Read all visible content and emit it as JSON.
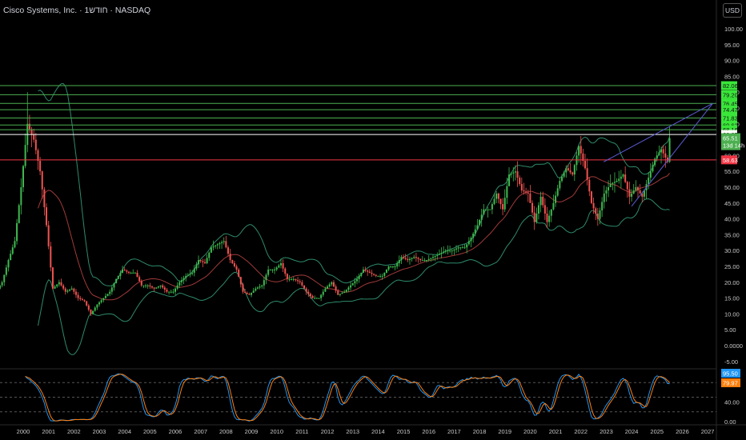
{
  "header": {
    "title": "Cisco Systems, Inc. · 1חודש · NASDAQ",
    "currency_button": "USD"
  },
  "colors": {
    "up": "#26a69a",
    "up_candle": "#3fb950",
    "down": "#ef5350",
    "level_line": "#4caf50",
    "level_tag": "#39e639",
    "support": "#f23645",
    "resistance": "#ffffff",
    "bands": "#2e8b6a",
    "basis": "#a13a3a",
    "trendline": "#5b5bd6",
    "k_line": "#2196f3",
    "d_line": "#ff7f0e"
  },
  "chart_data": [
    {
      "type": "candlestick",
      "title": "Cisco Systems, Inc. · 1חודש · NASDAQ",
      "x_tick_labels": [
        "2000",
        "2001",
        "2002",
        "2003",
        "2004",
        "2005",
        "2006",
        "2007",
        "2008",
        "2009",
        "2010",
        "2011",
        "2012",
        "2013",
        "2014",
        "2015",
        "2016",
        "2017",
        "2018",
        "2019",
        "2020",
        "2021",
        "2022",
        "2023",
        "2024",
        "2025",
        "2026",
        "2027"
      ],
      "y_tick_labels": [
        "100.00",
        "95.00",
        "90.00",
        "85.00",
        "80.00",
        "75.00",
        "70.00",
        "65.00",
        "60.00",
        "55.00",
        "50.00",
        "45.00",
        "40.00",
        "35.00",
        "30.00",
        "25.00",
        "20.00",
        "15.00",
        "10.00",
        "5.00",
        "0.0000",
        "-5.00"
      ],
      "ylim": [
        -5,
        100
      ],
      "start_year": 1999,
      "quarterly_close": [
        20,
        27,
        33,
        50,
        70,
        65,
        55,
        38,
        18,
        20,
        17,
        18,
        15,
        14,
        10,
        13,
        15,
        17,
        21,
        24,
        23,
        23,
        19,
        19,
        18,
        19,
        17,
        17,
        20,
        22,
        23,
        27,
        26,
        31,
        32,
        33,
        27,
        24,
        17,
        16,
        18,
        19,
        24,
        24,
        26,
        21,
        21,
        20,
        17,
        15,
        15,
        18,
        20,
        16,
        17,
        19,
        21,
        24,
        23,
        22,
        22,
        25,
        25,
        28,
        27,
        28,
        27,
        27,
        28,
        29,
        30,
        30,
        31,
        31,
        34,
        38,
        43,
        43,
        48,
        43,
        54,
        55,
        49,
        48,
        39,
        47,
        39,
        45,
        52,
        56,
        54,
        63,
        56,
        45,
        40,
        48,
        51,
        52,
        54,
        47,
        50,
        47,
        53,
        59,
        62,
        58,
        65.51
      ],
      "horizontal_levels": [
        {
          "value": 82.06,
          "label": "82.06",
          "kind": "level"
        },
        {
          "value": 79.2,
          "label": "79.20",
          "kind": "level"
        },
        {
          "value": 76.45,
          "label": "76.45",
          "kind": "level"
        },
        {
          "value": 74.47,
          "label": "74.47",
          "kind": "level"
        },
        {
          "value": 71.83,
          "label": "71.83",
          "kind": "level"
        },
        {
          "value": 69.63,
          "label": "69.63",
          "kind": "level"
        },
        {
          "value": 68.16,
          "label": "68.16",
          "kind": "level"
        },
        {
          "value": 66.65,
          "label": "66.65",
          "kind": "resistance"
        },
        {
          "value": 58.63,
          "label": "58.63",
          "kind": "support"
        }
      ],
      "last_price": {
        "value": 65.51,
        "label": "65.51",
        "countdown": "13d 14h"
      },
      "trendlines": [
        {
          "from": [
            2022.9,
            58
          ],
          "to": [
            2027.2,
            76.45
          ]
        },
        {
          "from": [
            2024.0,
            44
          ],
          "to": [
            2027.2,
            76.45
          ]
        }
      ]
    },
    {
      "type": "line",
      "ylim": [
        0,
        100
      ],
      "y_tick_labels": [
        "40.00",
        "0.00"
      ],
      "guide_levels": [
        80,
        50,
        20
      ],
      "series": [
        {
          "key": "k",
          "last_label": "95.50"
        },
        {
          "key": "d",
          "last_label": "79.97"
        }
      ]
    }
  ]
}
